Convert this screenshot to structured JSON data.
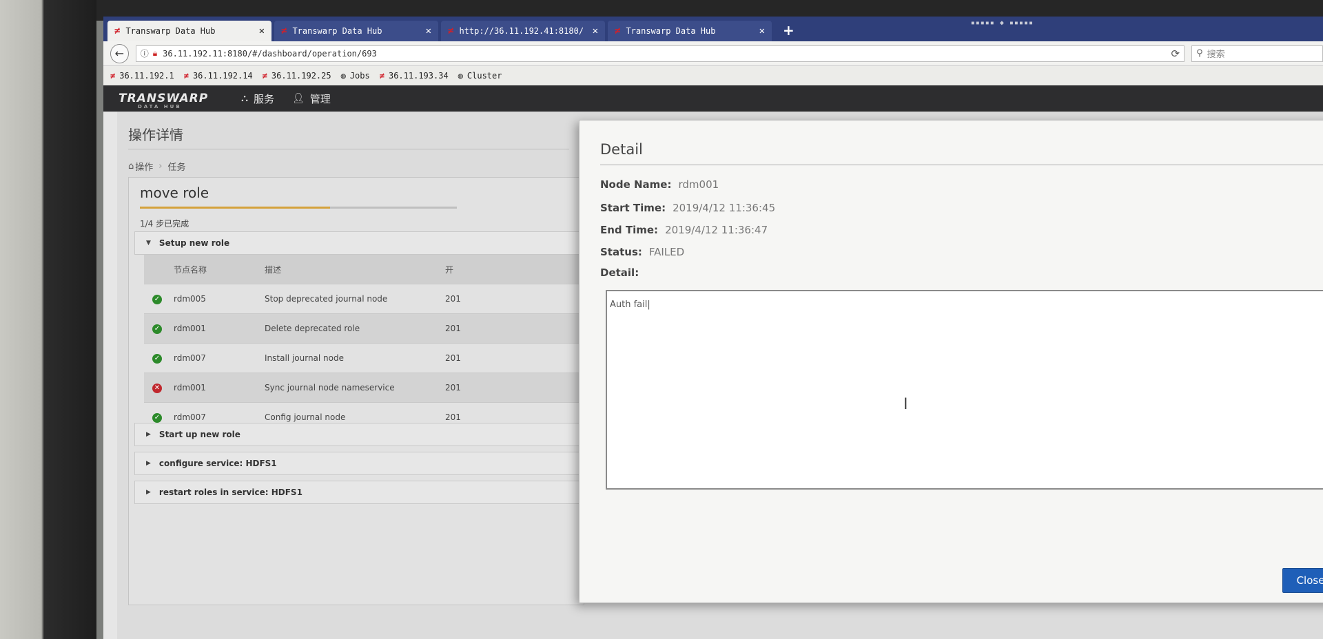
{
  "browser": {
    "tabs": [
      {
        "label": "Transwarp Data Hub",
        "active": true
      },
      {
        "label": "Transwarp Data Hub",
        "active": false
      },
      {
        "label": "http://36.11.192.41:8180/",
        "active": false
      },
      {
        "label": "Transwarp Data Hub",
        "active": false
      }
    ],
    "url": "36.11.192.11:8180/#/dashboard/operation/693",
    "search_placeholder": "搜索",
    "bookmarks": [
      {
        "label": "36.11.192.1",
        "icon": "transwarp-icon"
      },
      {
        "label": "36.11.192.14",
        "icon": "transwarp-icon"
      },
      {
        "label": "36.11.192.25",
        "icon": "transwarp-icon"
      },
      {
        "label": "Jobs",
        "icon": "globe-icon"
      },
      {
        "label": "36.11.193.34",
        "icon": "transwarp-icon"
      },
      {
        "label": "Cluster",
        "icon": "globe-icon"
      }
    ]
  },
  "app": {
    "logo": "TRANSWARP",
    "logo_sub": "DATA HUB",
    "nav": [
      {
        "label": "服务",
        "icon": "services-icon"
      },
      {
        "label": "管理",
        "icon": "user-icon"
      }
    ]
  },
  "page": {
    "title": "操作详情",
    "breadcrumb": [
      "操作",
      "任务"
    ]
  },
  "operation": {
    "title": "move role",
    "progress_text": "1/4 步已完成",
    "progress_fraction": 0.6,
    "sections": [
      {
        "label": "Setup new role",
        "expanded": true
      },
      {
        "label": "Start up new role",
        "expanded": false
      },
      {
        "label": "configure service: HDFS1",
        "expanded": false
      },
      {
        "label": "restart roles in service: HDFS1",
        "expanded": false
      }
    ],
    "table": {
      "headers": [
        "节点名称",
        "描述",
        "开"
      ],
      "rows": [
        {
          "status": "success",
          "node": "rdm005",
          "desc": "Stop deprecated journal node",
          "start": "201"
        },
        {
          "status": "success",
          "node": "rdm001",
          "desc": "Delete deprecated role",
          "start": "201"
        },
        {
          "status": "success",
          "node": "rdm007",
          "desc": "Install journal node",
          "start": "201"
        },
        {
          "status": "failed",
          "node": "rdm001",
          "desc": "Sync journal node nameservice",
          "start": "201"
        },
        {
          "status": "success",
          "node": "rdm007",
          "desc": "Config journal node",
          "start": "201"
        }
      ]
    }
  },
  "modal": {
    "title": "Detail",
    "node_name_label": "Node Name:",
    "node_name": "rdm001",
    "start_time_label": "Start Time:",
    "start_time": "2019/4/12 11:36:45",
    "end_time_label": "End Time:",
    "end_time": "2019/4/12 11:36:47",
    "status_label": "Status:",
    "status": "FAILED",
    "detail_label": "Detail:",
    "detail_text": "Auth fail",
    "close_label": "Close"
  },
  "colors": {
    "tabbar": "#2f3f7a",
    "app_header": "#2d2d2f",
    "success": "#2c8a2a",
    "failed": "#c0272d",
    "primary_button": "#1f5fb8",
    "progress": "#d4a23b"
  }
}
